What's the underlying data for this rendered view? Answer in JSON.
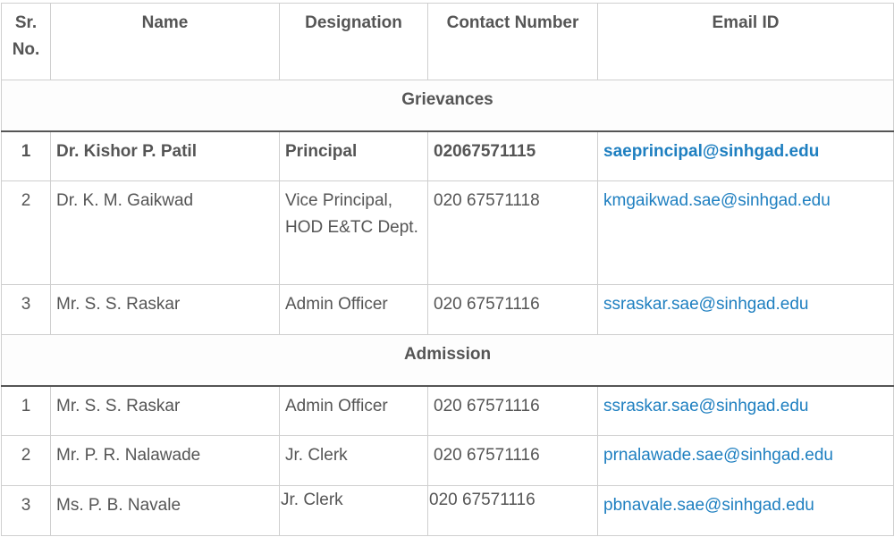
{
  "headers": {
    "sr_no": "Sr. No.",
    "name": "Name",
    "designation": "Designation",
    "contact": "Contact Number",
    "email": "Email ID"
  },
  "sections": [
    {
      "title": "Grievances",
      "rows": [
        {
          "sr": "1",
          "name": "Dr. Kishor P. Patil",
          "designation": "Principal",
          "contact": "02067571115",
          "email": "saeprincipal@sinhgad.edu"
        },
        {
          "sr": "2",
          "name": "Dr. K. M. Gaikwad",
          "designation": "Vice Principal, HOD E&TC Dept.",
          "contact": "020 67571118",
          "email": "kmgaikwad.sae@sinhgad.edu"
        },
        {
          "sr": "3",
          "name": "Mr. S. S. Raskar",
          "designation": "Admin Officer",
          "contact": "020 67571116",
          "email": "ssraskar.sae@sinhgad.edu"
        }
      ]
    },
    {
      "title": "Admission",
      "rows": [
        {
          "sr": "1",
          "name": "Mr. S. S. Raskar",
          "designation": "Admin Officer",
          "contact": "020 67571116",
          "email": "ssraskar.sae@sinhgad.edu"
        },
        {
          "sr": "2",
          "name": "Mr. P. R. Nalawade",
          "designation": "Jr. Clerk",
          "contact": "020 67571116",
          "email": "prnalawade.sae@sinhgad.edu"
        },
        {
          "sr": "3",
          "name": "Ms. P. B. Navale",
          "designation": "Jr. Clerk",
          "contact": "020 67571116",
          "email": "pbnavale.sae@sinhgad.edu"
        }
      ]
    }
  ],
  "colors": {
    "link": "#1e7fc0",
    "text": "#555555",
    "border": "#cfcfcf"
  }
}
